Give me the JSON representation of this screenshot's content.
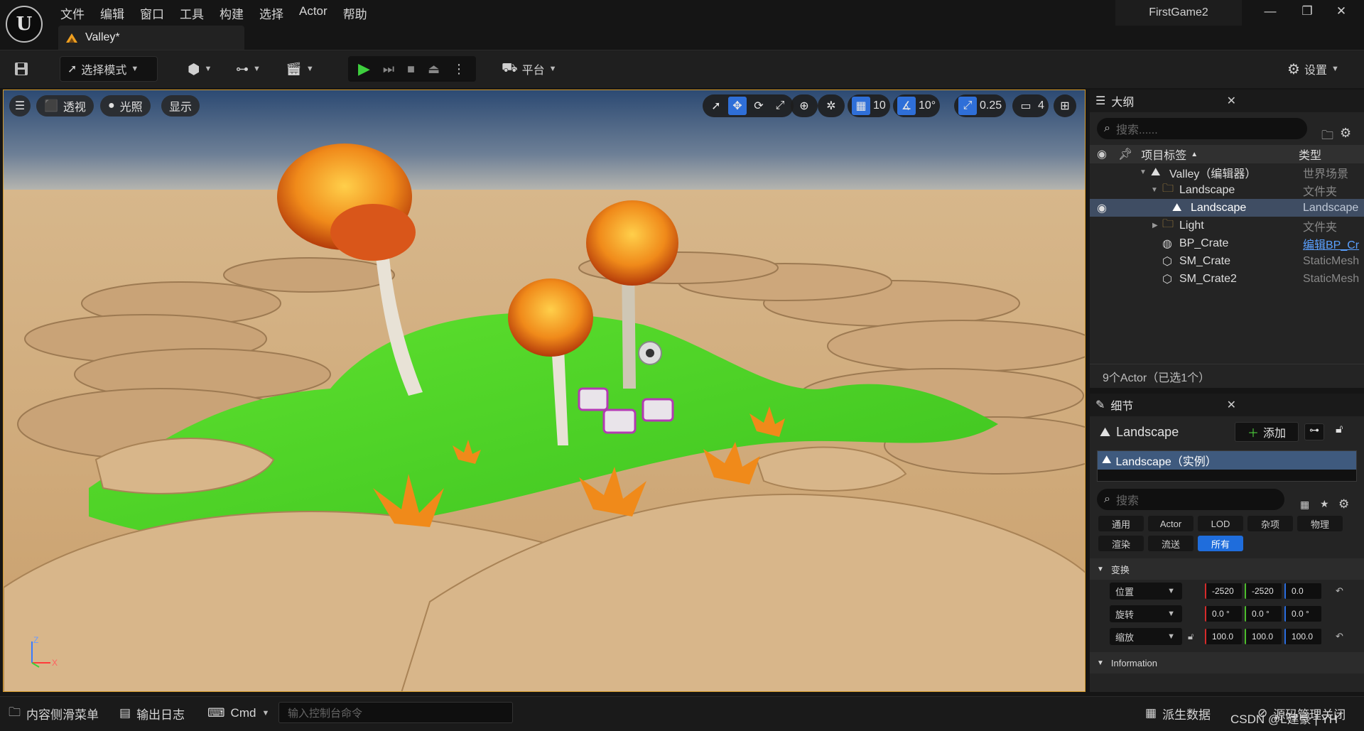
{
  "menu": [
    "文件",
    "编辑",
    "窗口",
    "工具",
    "构建",
    "选择",
    "Actor",
    "帮助"
  ],
  "doc_tab": "Valley*",
  "project_name": "FirstGame2",
  "toolbar": {
    "select_mode": "选择模式",
    "platform": "平台",
    "settings": "设置"
  },
  "viewport": {
    "perspective": "透视",
    "lighting": "光照",
    "show": "显示",
    "grid_snap": "10",
    "rot_snap": "10°",
    "scale_snap": "0.25",
    "camera_speed": "4",
    "axis_z": "Z",
    "axis_x": "X"
  },
  "outliner": {
    "title": "大纲",
    "search_placeholder": "搜索......",
    "col_label": "项目标签",
    "col_type": "类型",
    "rows": [
      {
        "label": "Valley（编辑器）",
        "type": "世界场景"
      },
      {
        "label": "Landscape",
        "type": "文件夹"
      },
      {
        "label": "Landscape",
        "type": "Landscape"
      },
      {
        "label": "Light",
        "type": "文件夹"
      },
      {
        "label": "BP_Crate",
        "type": "编辑BP_Cr"
      },
      {
        "label": "SM_Crate",
        "type": "StaticMesh"
      },
      {
        "label": "SM_Crate2",
        "type": "StaticMesh"
      }
    ],
    "status": "9个Actor（已选1个）"
  },
  "details": {
    "title": "细节",
    "object_name": "Landscape",
    "add_label": "添加",
    "component_selected": "Landscape（实例）",
    "search_placeholder": "搜索",
    "filters_row1": [
      "通用",
      "Actor",
      "LOD",
      "杂项",
      "物理"
    ],
    "filters_row2": [
      "渲染",
      "流送",
      "所有"
    ],
    "section_transform": "变换",
    "location_label": "位置",
    "rotation_label": "旋转",
    "scale_label": "缩放",
    "location": [
      "-2520",
      "-2520",
      "0.0"
    ],
    "rotation": [
      "0.0 °",
      "0.0 °",
      "0.0 °"
    ],
    "scale": [
      "100.0",
      "100.0",
      "100.0"
    ],
    "section_information": "Information"
  },
  "bottombar": {
    "content_drawer": "内容侧滑菜单",
    "output_log": "输出日志",
    "cmd": "Cmd",
    "console_placeholder": "输入控制台命令",
    "derived_data": "派生数据",
    "source_control": "源码管理关闭"
  },
  "watermark": "CSDN @L建豪 | YH"
}
